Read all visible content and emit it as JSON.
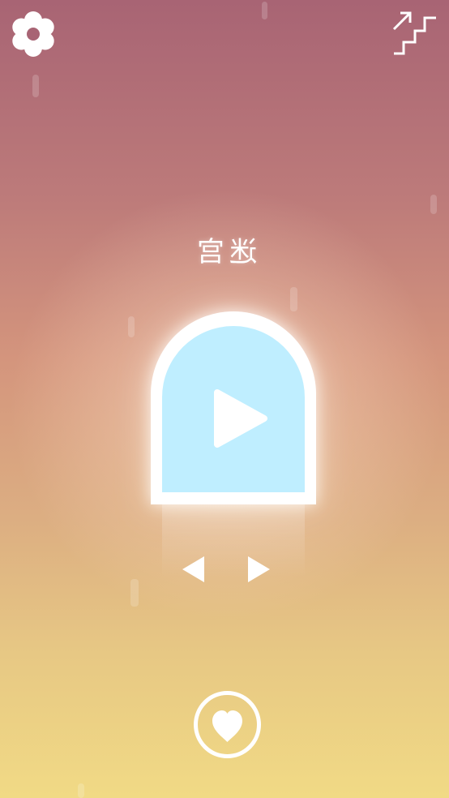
{
  "level": {
    "title": "迷宫",
    "title_mirrored": true
  },
  "icons": {
    "settings": "gear-icon",
    "levels": "stairs-icon",
    "play": "play-icon",
    "previous": "triangle-left-icon",
    "next": "triangle-right-icon",
    "favorite": "heart-icon"
  },
  "colors": {
    "background_top": "#a86474",
    "background_bottom": "#f1da85",
    "card_frame": "#ffffff",
    "card_fill": "#bfeeff",
    "icon": "#ffffff"
  }
}
